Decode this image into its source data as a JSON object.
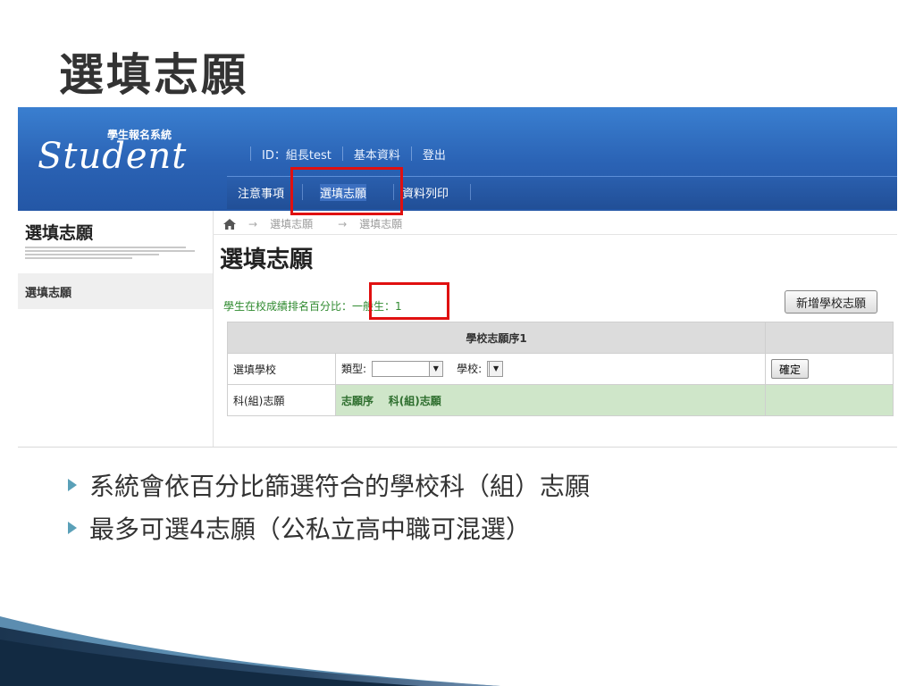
{
  "slide": {
    "title": "選填志願",
    "bullets": [
      "系統會依百分比篩選符合的學校科（組）志願",
      "最多可選4志願（公私立高中職可混選）"
    ]
  },
  "header": {
    "logo_sub": "學生報名系統",
    "logo": "Student",
    "id_label": "ID：組長test",
    "profile_link": "基本資料",
    "logout_link": "登出"
  },
  "tabs": [
    "注意事項",
    "選填志願",
    "資料列印"
  ],
  "sidebar": {
    "title": "選填志願",
    "item": "選填志願"
  },
  "breadcrumb": [
    "選填志願",
    "選填志願"
  ],
  "main": {
    "heading": "選填志願",
    "percentile_label": "學生在校成績排名百分比",
    "percentile_value": "：一般生：1",
    "add_button": "新增學校志願",
    "table": {
      "header": "學校志願序1",
      "row1_label": "選填學校",
      "type_label": "類型:",
      "school_label": "學校:",
      "confirm_button": "確定",
      "row2_label": "科(組)志願",
      "col_order": "志願序",
      "col_dept": "科(組)志願"
    }
  },
  "colors": {
    "header_blue": "#2a62b4",
    "highlight_red": "#e01010",
    "green_text": "#2f8a2f"
  }
}
